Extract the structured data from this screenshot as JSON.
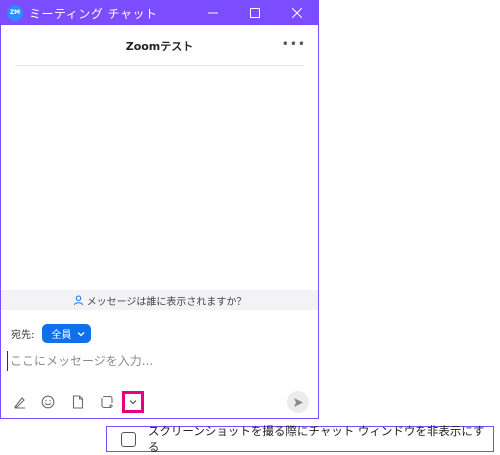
{
  "window": {
    "title": "ミーティング チャット",
    "logo_text": "ZM"
  },
  "chat": {
    "title": "Zoomテスト",
    "more_icon": "ellipsis-icon",
    "privacy_notice": "メッセージは誰に表示されますか？"
  },
  "recipient": {
    "label": "宛先:",
    "selected": "全員"
  },
  "composer": {
    "placeholder": "ここにメッセージを入力..."
  },
  "toolbar": {
    "icons": [
      "format-icon",
      "emoji-icon",
      "file-icon",
      "screenshot-icon",
      "chevron-down-icon",
      "send-icon"
    ]
  },
  "screenshot_option": {
    "label": "スクリーンショットを撮る際にチャット ウィンドウを非表示にする",
    "checked": false
  },
  "colors": {
    "titlebar": "#7c4dff",
    "accent": "#0e71eb",
    "highlight": "#e6007e"
  }
}
